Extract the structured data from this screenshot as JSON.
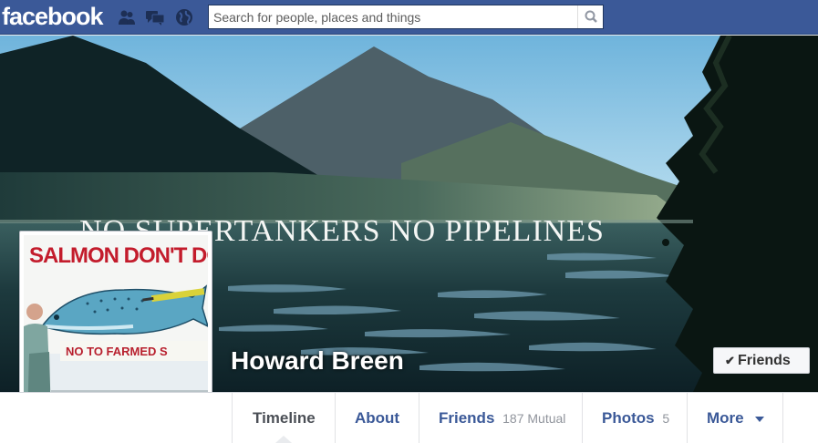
{
  "topbar": {
    "logo": "facebook",
    "search_placeholder": "Search for people, places and things",
    "icons": [
      "friend-requests-icon",
      "messages-icon",
      "notifications-globe-icon",
      "search-icon"
    ]
  },
  "cover": {
    "headline": "NO SUPERTANKERS NO PIPELINES"
  },
  "profile_pic": {
    "sign_top": "SALMON DON'T DO",
    "sign_bottom": "NO TO FARMED S"
  },
  "profile": {
    "name": "Howard Breen",
    "relationship_button": "Friends"
  },
  "nav": {
    "tabs": [
      {
        "label": "Timeline",
        "count": ""
      },
      {
        "label": "About",
        "count": ""
      },
      {
        "label": "Friends",
        "count": "187 Mutual"
      },
      {
        "label": "Photos",
        "count": "5"
      },
      {
        "label": "More",
        "count": ""
      }
    ],
    "active_tab": "Timeline"
  },
  "colors": {
    "brand": "#3b5998",
    "page_bg": "#e9ebee"
  }
}
